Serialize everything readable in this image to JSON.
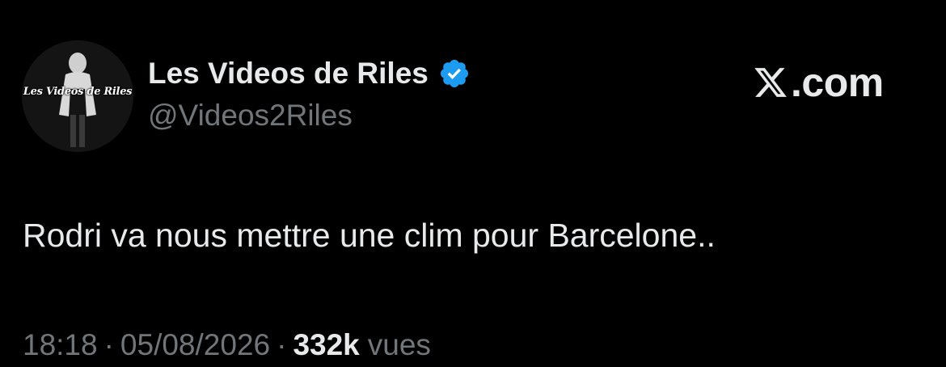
{
  "profile": {
    "avatar_text": "Les Videos de Riles",
    "display_name": "Les Videos de Riles",
    "handle": "@Videos2Riles",
    "verified_icon": "verified-badge-icon"
  },
  "site": {
    "logo_icon": "x-logo-icon",
    "domain": ".com"
  },
  "tweet": {
    "text": "Rodri va nous mettre une clim pour Barcelone.."
  },
  "meta": {
    "time": "18:18",
    "separator": "·",
    "date": "05/08/2026",
    "views_count": "332k",
    "views_label": "vues"
  },
  "colors": {
    "background": "#000000",
    "primary_text": "#e7e9ea",
    "secondary_text": "#71767b",
    "verified_blue": "#1d9bf0"
  }
}
